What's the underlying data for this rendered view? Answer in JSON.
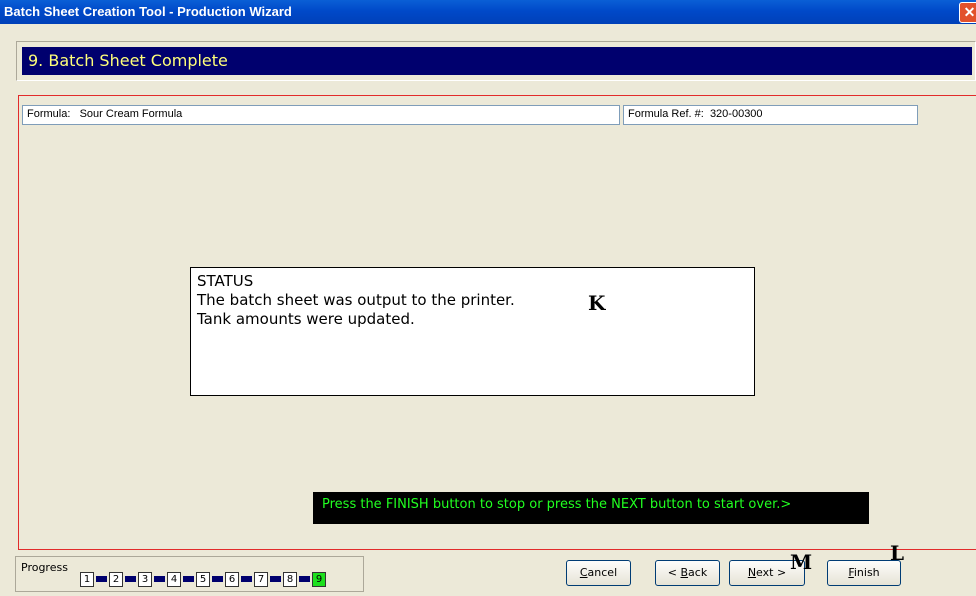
{
  "window": {
    "title": "Batch Sheet Creation Tool - Production Wizard",
    "close_glyph": "✕"
  },
  "step": {
    "title": "9. Batch Sheet Complete"
  },
  "formula": {
    "label": "Formula:",
    "name": "Sour Cream Formula",
    "ref_label": "Formula Ref. #:",
    "ref_value": "320-00300"
  },
  "status": {
    "heading": "STATUS",
    "line1": "The batch sheet was output to the printer.",
    "line2": "Tank amounts were updated."
  },
  "markers": {
    "k": "K",
    "m": "M",
    "l": "L"
  },
  "message": "Press the FINISH button to stop or press the NEXT button to start over.>",
  "progress": {
    "label": "Progress",
    "steps": [
      "1",
      "2",
      "3",
      "4",
      "5",
      "6",
      "7",
      "8",
      "9"
    ],
    "current": "9"
  },
  "buttons": {
    "cancel": {
      "u": "C",
      "rest": "ancel"
    },
    "back": {
      "pre": "< ",
      "u": "B",
      "rest": "ack"
    },
    "next": {
      "u": "N",
      "rest": "ext >"
    },
    "finish": {
      "u": "F",
      "rest": "inish"
    }
  },
  "colors": {
    "title_bar": "#0049c9",
    "step_header_bg": "#00006e",
    "step_header_text": "#ffff7a",
    "panel_border": "#e22b2b",
    "message_bg": "#000000",
    "message_text": "#21ff21",
    "progress_current": "#1de01d"
  }
}
